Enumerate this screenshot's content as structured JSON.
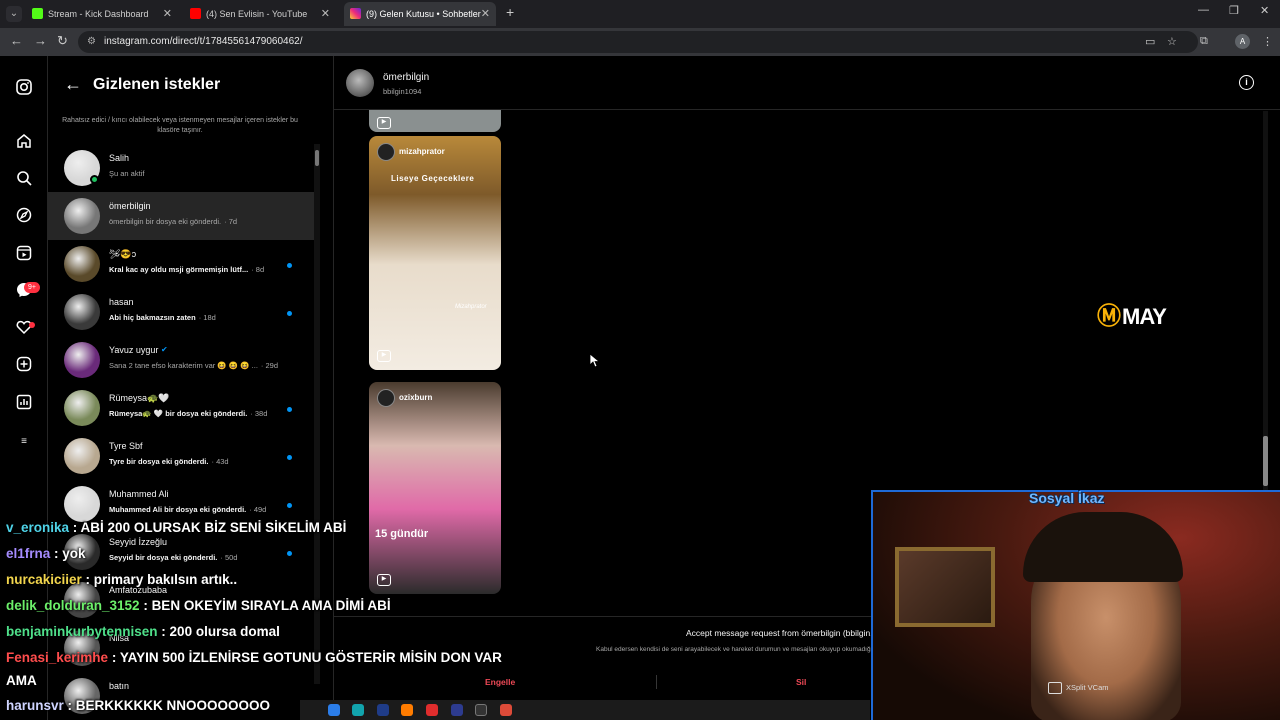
{
  "browser": {
    "tabs": [
      {
        "title": "Stream - Kick Dashboard",
        "color": "#53fc18",
        "active": false
      },
      {
        "title": "(4) Sen Evlisin - YouTube",
        "color": "#ff0000",
        "active": false
      },
      {
        "title": "(9) Gelen Kutusu • Sohbetler",
        "color": "#e1306c",
        "active": true
      }
    ],
    "url": "instagram.com/direct/t/17845561479060462/",
    "profile_initial": "A"
  },
  "rail": {
    "icons": [
      "instagram-logo-icon",
      "home-icon",
      "search-icon",
      "explore-icon",
      "reels-icon",
      "messages-icon",
      "notifications-icon",
      "create-icon",
      "dashboard-icon",
      "more-icon"
    ],
    "messages_badge": "9+"
  },
  "panel": {
    "title": "Gizlenen istekler",
    "description": "Rahatsız edici / kırıcı olabilecek veya istenmeyen mesajlar içeren istekler bu klasöre taşınır.",
    "items": [
      {
        "name": "Salih",
        "preview": "Şu an aktif",
        "time": "",
        "unread": false,
        "online": true,
        "selected": false,
        "avatar": "#d8d8d8"
      },
      {
        "name": "ömerbilgin",
        "preview": "ömerbilgin bir dosya eki gönderdi.",
        "time": "· 7d",
        "unread": false,
        "online": false,
        "selected": true,
        "avatar": "#777"
      },
      {
        "name": "🛩😎ɔ",
        "preview": "Kral kac ay oldu msji görmemişin lütf...",
        "time": "· 8d",
        "unread": true,
        "online": false,
        "selected": false,
        "avatar": "#5a4a2a"
      },
      {
        "name": "hasan",
        "preview": "Abi hiç bakmazsın zaten",
        "time": "· 18d",
        "unread": true,
        "online": false,
        "selected": false,
        "avatar": "#3a3a3a"
      },
      {
        "name": "Yavuz uygur",
        "preview": "Sana 2 tane efso karakterim var 😆 😆 😆 ...",
        "time": "· 29d",
        "unread": false,
        "online": false,
        "selected": false,
        "avatar": "#6a2a7a",
        "verified": true
      },
      {
        "name": "Rümeysa🐢🤍",
        "preview": "Rümeysa🐢 🤍 bir dosya eki gönderdi.",
        "time": "· 38d",
        "unread": true,
        "online": false,
        "selected": false,
        "avatar": "#7a8a5a"
      },
      {
        "name": "Tyre Sbf",
        "preview": "Tyre bir dosya eki gönderdi.",
        "time": "· 43d",
        "unread": true,
        "online": false,
        "selected": false,
        "avatar": "#b8a890"
      },
      {
        "name": "Muhammed Ali",
        "preview": "Muhammed Ali bir dosya eki gönderdi.",
        "time": "· 49d",
        "unread": true,
        "online": false,
        "selected": false,
        "avatar": "#d8d8d8"
      },
      {
        "name": "Seyyid İzzeğlu",
        "preview": "Seyyid bir dosya eki gönderdi.",
        "time": "· 50d",
        "unread": true,
        "online": false,
        "selected": false,
        "avatar": "#2a2a2a"
      },
      {
        "name": "Amfatozubaba",
        "preview": "",
        "time": "",
        "unread": false,
        "online": false,
        "selected": false,
        "avatar": "#444"
      },
      {
        "name": "Nilsa",
        "preview": "",
        "time": "",
        "unread": false,
        "online": false,
        "selected": false,
        "avatar": "#555"
      },
      {
        "name": "batın",
        "preview": "",
        "time": "",
        "unread": false,
        "online": false,
        "selected": false,
        "avatar": "#666"
      }
    ]
  },
  "chat": {
    "name": "ömerbilgin",
    "username": "bbilgin1094",
    "reels": [
      {
        "user": "mizahprator",
        "caption": "Liseye Geçeceklere",
        "watermark": "Mizahprator",
        "bg": "linear-gradient(180deg,#b9893a 0%,#7e5a2a 25%,#e8dccb 55%,#f3ece2 100%)"
      },
      {
        "user": "ozixburn",
        "caption": "15 gündür",
        "watermark": "",
        "bg": "linear-gradient(180deg,#4a3b2e 0%,#d9b9b0 30%,#e06aa8 60%,#2b2b2b 100%)"
      }
    ],
    "accept_title": "Accept message request from ömerbilgin (bbilgin1094)?",
    "accept_subtitle": "Kabul edersen kendisi de seni arayabilecek ve hareket durumun ve mesajları okuyup okumadığın gibi bilgileri görebilecek.",
    "buttons": {
      "block": "Engelle",
      "delete": "Sil"
    }
  },
  "overlay": {
    "brand_logo_text": "MAY",
    "stream_chat": [
      {
        "user": "v_eronika",
        "message": "ABİ 200 OLURSAK BİZ SENİ SİKELİM ABİ",
        "color": "#4fd3e8"
      },
      {
        "user": "el1frna",
        "message": "yok",
        "color": "#a58cff"
      },
      {
        "user": "nurcakiciier",
        "message": "primary bakılsın artık..",
        "color": "#f2d54d"
      },
      {
        "user": "delik_dolduran_3152",
        "message": "BEN OKEYİM SIRAYLA AMA DİMİ ABİ",
        "color": "#6cf06a"
      },
      {
        "user": "benjaminkurbytennisen",
        "message": "200 olursa domal",
        "color": "#4fe08a"
      },
      {
        "user": "Fenasi_kerimhe",
        "message": "YAYIN 500 İZLENİRSE GOTUNU GÖSTERİR MİSİN DON VAR",
        "color": "#ff4d4d"
      },
      {
        "user": "",
        "message": "AMA",
        "color": "#ffffff"
      },
      {
        "user": "harunsvr",
        "message": "BERKKKKKK NNOOOOOOOO",
        "color": "#cfd4ff"
      }
    ],
    "cam_title": "Sosyal İkaz",
    "cam_watermark": "XSplit VCam"
  }
}
